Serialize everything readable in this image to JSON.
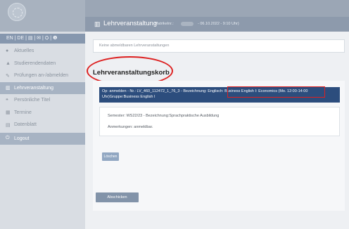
{
  "sidebar": {
    "langbar": "EN | DE | ▤ | ✉ | ⛭ | ❶",
    "items": [
      {
        "label": "Aktuelles",
        "icon": "chat-icon"
      },
      {
        "label": "Studierendendaten",
        "icon": "graduation-cap-icon"
      },
      {
        "label": "Prüfungen an-/abmelden",
        "icon": "edit-icon"
      },
      {
        "label": "Lehrveranstaltung",
        "icon": "university-icon",
        "active": true
      },
      {
        "label": "Persönliche Titel",
        "icon": "quote-icon"
      },
      {
        "label": "Termine",
        "icon": "calendar-icon"
      },
      {
        "label": "Datenblatt",
        "icon": "document-icon"
      },
      {
        "label": "Logout",
        "icon": "power-icon"
      }
    ]
  },
  "header": {
    "title": "Lehrveranstaltung",
    "subtitle_prefix": "(Matrikelnr.:",
    "subtitle_date": "- 06.10.2022 - 9:10 Uhr)"
  },
  "main": {
    "notice": "Keine abmeldbaren Lehrveranstaltungen",
    "heading": "Lehrveranstaltungskorb",
    "course_bar": "Op: anmelden - Nr.: LV_460_112472_1_76_3 - Bezeichnung: Englisch: Business English I: Economics (Mo. 12:00-14:00 Uhr)Gruppe:Business English I",
    "semester_line": "Semester: WS22/23 - Bezeichnung:Sprachpraktische Ausbildung",
    "remarks_line": "Anmerkungen: anmeldbar.",
    "delete_label": "Löschen",
    "submit_label": "Abschicken"
  },
  "colors": {
    "sidebar_active": "#a7b3c3",
    "titlebar": "#8d9aac",
    "course_bar": "#2c4d7d",
    "annotation": "#dd1f1f"
  }
}
